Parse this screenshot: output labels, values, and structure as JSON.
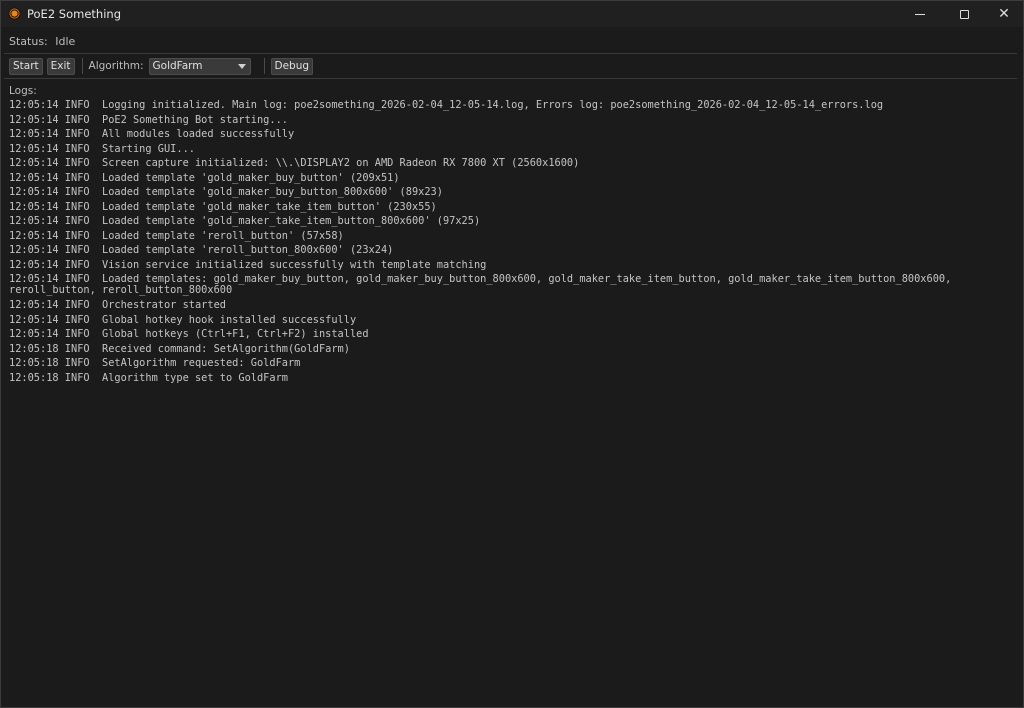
{
  "window": {
    "title": "PoE2 Something",
    "icon": "poe2-app-icon",
    "minimize_icon": "minimize-icon",
    "maximize_icon": "maximize-icon",
    "close_icon": "close-icon",
    "close_glyph": "✕"
  },
  "status": {
    "label": "Status:",
    "value": "Idle"
  },
  "toolbar": {
    "start_label": "Start",
    "exit_label": "Exit",
    "algorithm_label": "Algorithm:",
    "algorithm_selected": "GoldFarm",
    "debug_label": "Debug"
  },
  "logs": {
    "label": "Logs:",
    "lines": [
      "12:05:14 INFO  Logging initialized. Main log: poe2something_2026-02-04_12-05-14.log, Errors log: poe2something_2026-02-04_12-05-14_errors.log",
      "12:05:14 INFO  PoE2 Something Bot starting...",
      "12:05:14 INFO  All modules loaded successfully",
      "12:05:14 INFO  Starting GUI...",
      "12:05:14 INFO  Screen capture initialized: \\\\.\\DISPLAY2 on AMD Radeon RX 7800 XT (2560x1600)",
      "12:05:14 INFO  Loaded template 'gold_maker_buy_button' (209x51)",
      "12:05:14 INFO  Loaded template 'gold_maker_buy_button_800x600' (89x23)",
      "12:05:14 INFO  Loaded template 'gold_maker_take_item_button' (230x55)",
      "12:05:14 INFO  Loaded template 'gold_maker_take_item_button_800x600' (97x25)",
      "12:05:14 INFO  Loaded template 'reroll_button' (57x58)",
      "12:05:14 INFO  Loaded template 'reroll_button_800x600' (23x24)",
      "12:05:14 INFO  Vision service initialized successfully with template matching",
      "12:05:14 INFO  Loaded templates: gold_maker_buy_button, gold_maker_buy_button_800x600, gold_maker_take_item_button, gold_maker_take_item_button_800x600,\nreroll_button, reroll_button_800x600",
      "12:05:14 INFO  Orchestrator started",
      "12:05:14 INFO  Global hotkey hook installed successfully",
      "12:05:14 INFO  Global hotkeys (Ctrl+F1, Ctrl+F2) installed",
      "12:05:18 INFO  Received command: SetAlgorithm(GoldFarm)",
      "12:05:18 INFO  SetAlgorithm requested: GoldFarm",
      "12:05:18 INFO  Algorithm type set to GoldFarm"
    ]
  },
  "colors": {
    "background": "#1b1b1b",
    "titlebar": "#202020",
    "button_bg": "#3a3a3a",
    "text": "#c4c4c4"
  }
}
